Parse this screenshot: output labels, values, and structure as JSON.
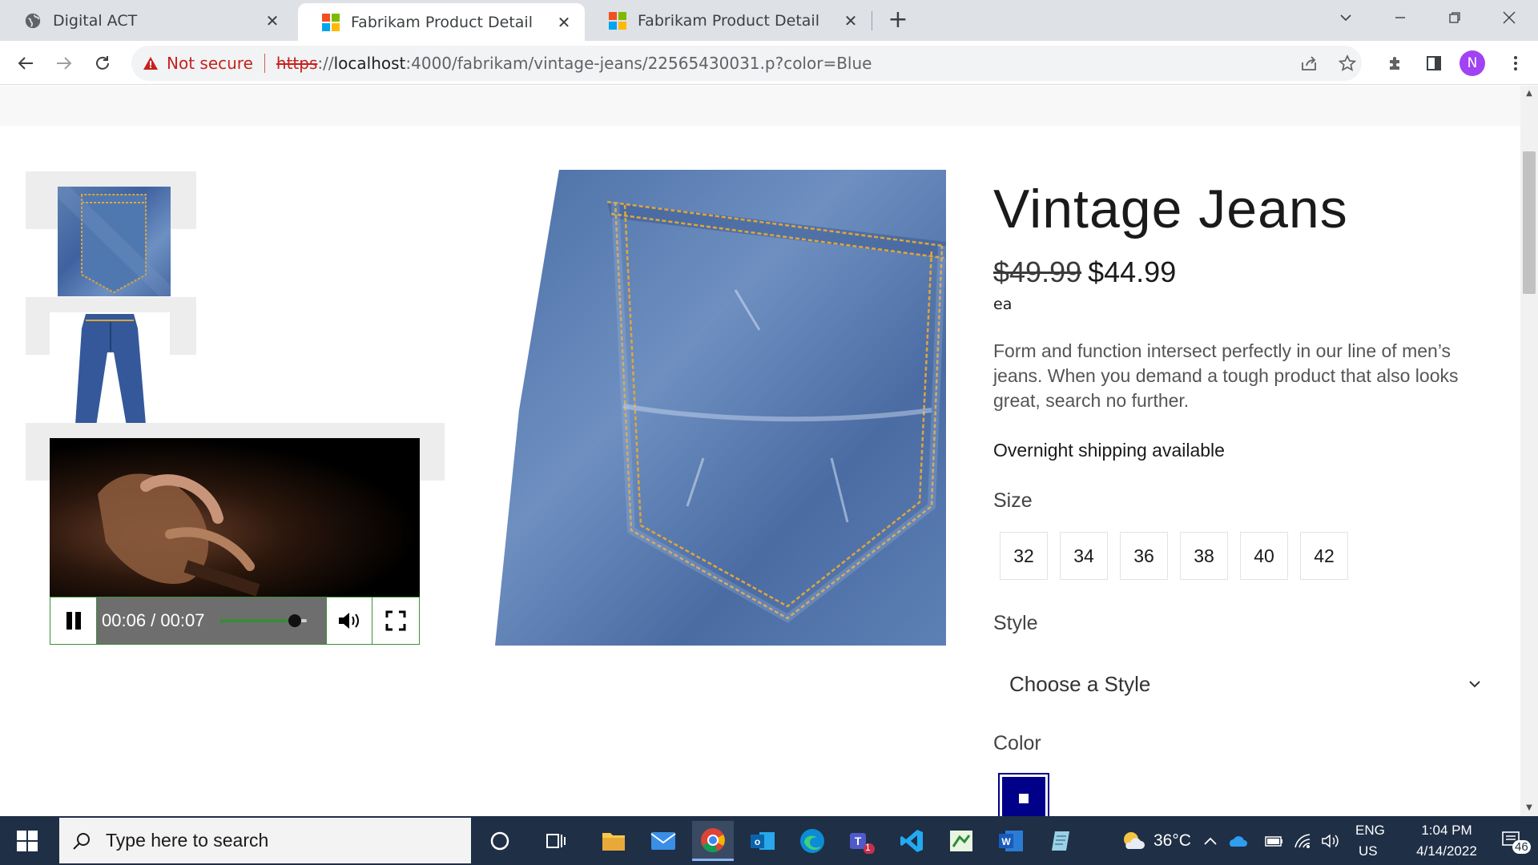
{
  "browser": {
    "tabs": [
      {
        "title": "Digital ACT",
        "active": false
      },
      {
        "title": "Fabrikam Product Detail",
        "active": true
      },
      {
        "title": "Fabrikam Product Detail",
        "active": false
      }
    ],
    "security_label": "Not secure",
    "url_scheme": "https",
    "url_after_scheme": "://",
    "url_host": "localhost",
    "url_path": ":4000/fabrikam/vintage-jeans/22565430031.p?color=Blue",
    "avatar_letter": "N"
  },
  "product": {
    "title": "Vintage Jeans",
    "old_price": "$49.99",
    "price": "$44.99",
    "unit": "ea",
    "description": "Form and function intersect perfectly in our line of men’s jeans. When you demand a tough product that also looks great, search no further.",
    "shipping": "Overnight shipping available",
    "size_label": "Size",
    "sizes": [
      "32",
      "34",
      "36",
      "38",
      "40",
      "42"
    ],
    "style_label": "Style",
    "style_placeholder": "Choose a Style",
    "color_label": "Color",
    "selected_color": "#000088"
  },
  "video": {
    "time": "00:06 / 00:07",
    "progress_fraction": 0.857
  },
  "taskbar": {
    "search_placeholder": "Type here to search",
    "weather": "36°C",
    "language": "ENG",
    "region": "US",
    "time": "1:04 PM",
    "date": "4/14/2022",
    "notification_count": "46",
    "teams_badge": "1"
  }
}
